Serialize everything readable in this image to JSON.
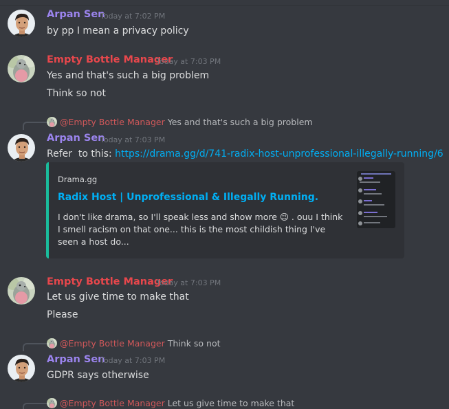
{
  "messages": [
    {
      "author": "Arpan Sen",
      "timestamp": "Today at 7:02 PM",
      "lines": [
        "by pp I mean a privacy policy"
      ]
    },
    {
      "author": "Empty Bottle Manager",
      "timestamp": "Today at 7:03 PM",
      "lines": [
        "Yes and that's such a big problem",
        "Think so not"
      ]
    },
    {
      "reply": {
        "mention": "@Empty Bottle Manager",
        "text": "Yes and that's such a big problem"
      },
      "author": "Arpan Sen",
      "timestamp": "Today at 7:03 PM",
      "text_prefix": "Refer  to this: ",
      "link": "https://drama.gg/d/741-radix-host-unprofessional-illegally-running/6",
      "embed": {
        "provider": "Drama.gg",
        "title": "Radix Host | Unprofessional & Illegally Running.",
        "description_before_emoji": "I don't like drama, so I'll speak less and show more",
        "emoji": "😉",
        "description_after_emoji": " . ouu I think I smell racism on that one... this is the most childish thing I've seen a host do...",
        "accent_color": "#1abc9c"
      }
    },
    {
      "author": "Empty Bottle Manager",
      "timestamp": "Today at 7:03 PM",
      "lines": [
        "Let us give time to make that",
        "Please"
      ]
    },
    {
      "reply": {
        "mention": "@Empty Bottle Manager",
        "text": "Think so not"
      },
      "author": "Arpan Sen",
      "timestamp": "Today at 7:03 PM",
      "lines": [
        "GDPR says otherwise"
      ]
    },
    {
      "reply": {
        "mention": "@Empty Bottle Manager",
        "text": "Let us give time to make that"
      }
    }
  ],
  "colors": {
    "background": "#36393f",
    "arpan_name": "#9b84ee",
    "ebm_name": "#e8474c",
    "link": "#00aff4",
    "embed_bg": "#2f3136"
  },
  "icons": {
    "arpan_avatar": "user-photo-avatar",
    "ebm_avatar": "bird-avatar"
  }
}
